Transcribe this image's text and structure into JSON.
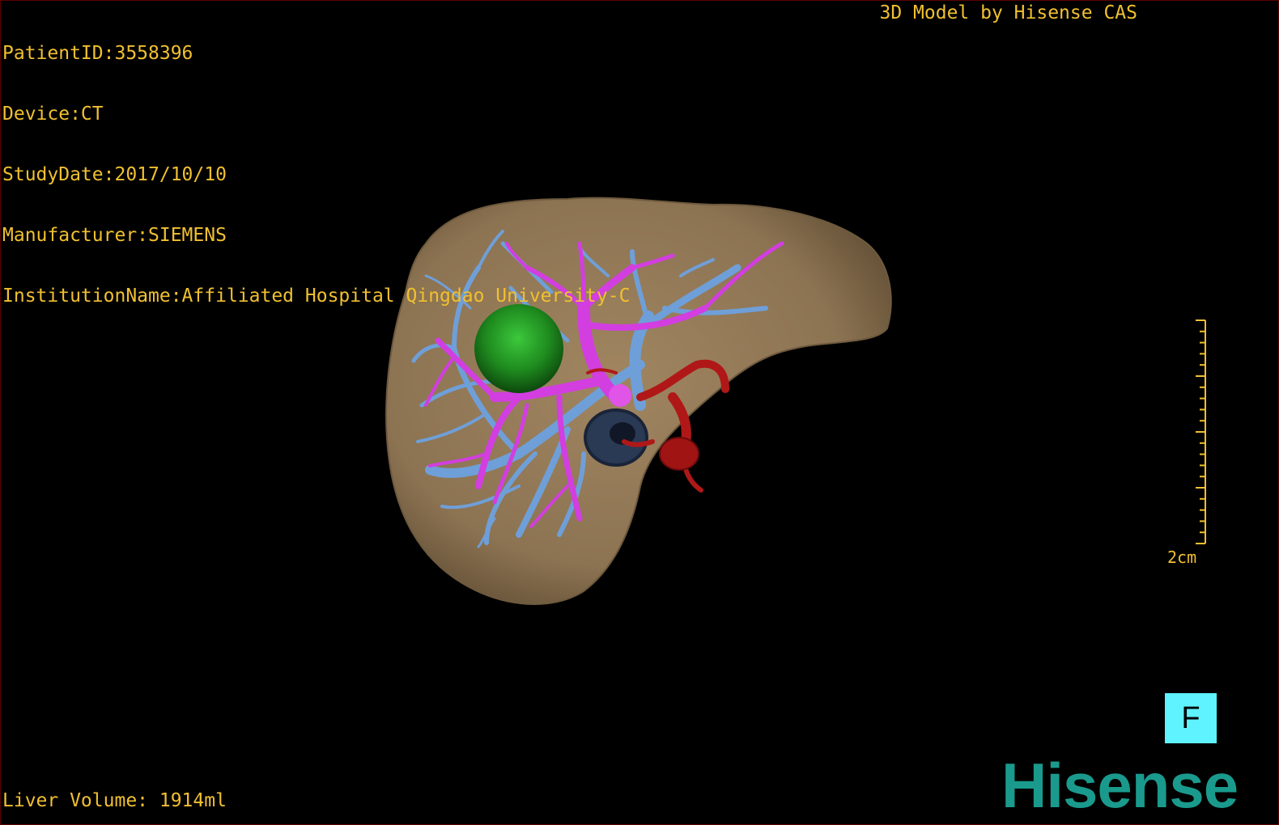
{
  "overlay": {
    "patient_id": "PatientID:3558396",
    "device": "Device:CT",
    "study_date": "StudyDate:2017/10/10",
    "manufacturer": "Manufacturer:SIEMENS",
    "institution": "InstitutionName:Affiliated Hospital Qingdao University-C",
    "brand_note": "3D Model by Hisense CAS",
    "liver_volume": "Liver Volume: 1914ml"
  },
  "scale": {
    "label": "2cm"
  },
  "orientation": {
    "label": "F"
  },
  "logo": {
    "text": "Hisense"
  },
  "colors": {
    "text": "#f0c030",
    "liver": "#8c7352",
    "portal_vein": "#6f9fd8",
    "hepatic_vein": "#d23ee0",
    "tumor": "#1e8a1e",
    "artery": "#b01818",
    "ivc": "#2a3a55",
    "orientation_cube": "#5ef3ff",
    "logo": "#1a9a8c"
  }
}
